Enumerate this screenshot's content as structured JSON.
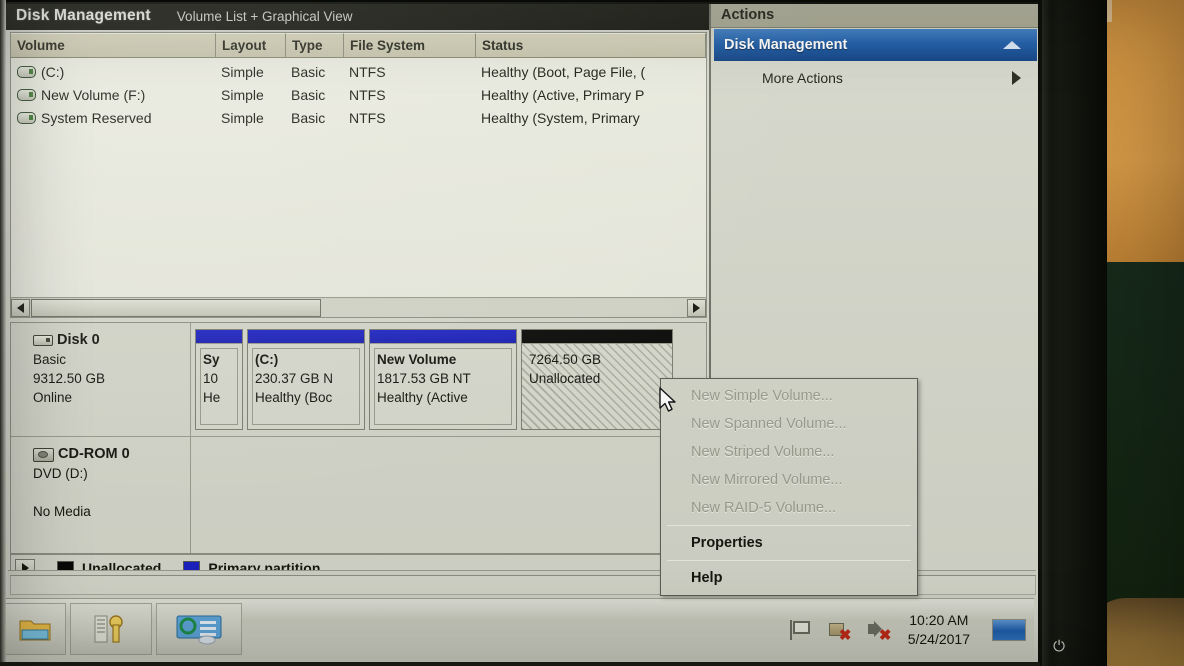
{
  "window": {
    "title": "Disk Management",
    "subtitle": "Volume List + Graphical View"
  },
  "volume_list": {
    "columns": [
      "Volume",
      "Layout",
      "Type",
      "File System",
      "Status"
    ],
    "rows": [
      {
        "icon": "drive-icon",
        "volume": "(C:)",
        "layout": "Simple",
        "type": "Basic",
        "file_system": "NTFS",
        "status": "Healthy (Boot, Page File, ("
      },
      {
        "icon": "drive-icon",
        "volume": "New Volume (F:)",
        "layout": "Simple",
        "type": "Basic",
        "file_system": "NTFS",
        "status": "Healthy (Active, Primary P"
      },
      {
        "icon": "drive-icon",
        "volume": "System Reserved",
        "layout": "Simple",
        "type": "Basic",
        "file_system": "NTFS",
        "status": "Healthy (System, Primary"
      }
    ]
  },
  "disks": [
    {
      "name": "Disk 0",
      "type": "Basic",
      "capacity": "9312.50 GB",
      "state": "Online",
      "partitions": [
        {
          "name": "Sy",
          "size": "10",
          "status": "He",
          "bar": "blue",
          "fill": "solid"
        },
        {
          "name": "(C:)",
          "size": "230.37 GB N",
          "status": "Healthy (Boc",
          "bar": "blue",
          "fill": "solid"
        },
        {
          "name": "New Volume",
          "size": "1817.53 GB NT",
          "status": "Healthy (Active",
          "bar": "blue",
          "fill": "solid"
        },
        {
          "name": "",
          "size": "7264.50 GB",
          "status": "Unallocated",
          "bar": "black",
          "fill": "hatched"
        }
      ]
    },
    {
      "name": "CD-ROM 0",
      "type": "DVD (D:)",
      "capacity": "",
      "state": "No Media",
      "partitions": []
    }
  ],
  "legend": [
    {
      "color": "#070805",
      "label": "Unallocated"
    },
    {
      "color": "#1b20c4",
      "label": "Primary partition"
    }
  ],
  "actions_pane": {
    "header": "Actions",
    "group_label": "Disk Management",
    "more_actions": "More Actions"
  },
  "context_menu": {
    "items": [
      {
        "label": "New Simple Volume...",
        "enabled": false
      },
      {
        "label": "New Spanned Volume...",
        "enabled": false
      },
      {
        "label": "New Striped Volume...",
        "enabled": false
      },
      {
        "label": "New Mirrored Volume...",
        "enabled": false
      },
      {
        "label": "New RAID-5 Volume...",
        "enabled": false
      },
      {
        "label": "Properties",
        "enabled": true
      },
      {
        "label": "Help",
        "enabled": true
      }
    ]
  },
  "taskbar": {
    "buttons": [
      {
        "icon": "folder-explorer-icon"
      },
      {
        "icon": "tool-key-icon"
      },
      {
        "icon": "control-panel-icon"
      }
    ],
    "tray": {
      "flag_icon": "flag-icon",
      "network_icon": "network-disconnected-icon",
      "volume_icon": "speaker-muted-icon",
      "time": "10:20 AM",
      "date": "5/24/2017",
      "show_desktop": "show-desktop-button"
    }
  },
  "colors": {
    "accent_blue": "#1b20c4",
    "header_blue": "#1b5ca8",
    "unallocated_black": "#070805",
    "chrome": "#d5d7cb"
  }
}
